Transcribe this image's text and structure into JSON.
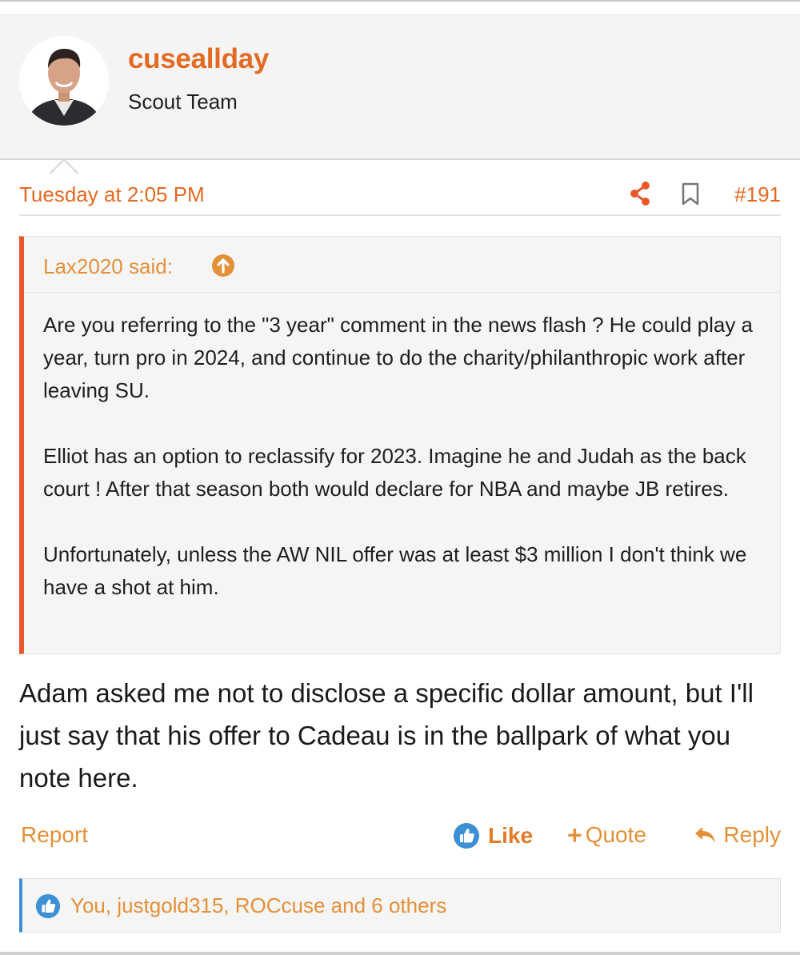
{
  "author": {
    "username": "cuseallday",
    "title": "Scout Team",
    "avatar": "avatar"
  },
  "post": {
    "date": "Tuesday at 2:05 PM",
    "number": "#191",
    "share_icon": "share-icon",
    "bookmark_icon": "bookmark-icon"
  },
  "quote": {
    "author_label": "Lax2020 said:",
    "jump_icon": "arrow-up-circle-icon",
    "paragraphs": [
      "Are you referring to the \"3 year\" comment in the news flash ? He could play a year, turn pro in 2024, and continue to do the charity/philanthropic work after leaving SU.",
      "Elliot has an option to reclassify for 2023. Imagine he and Judah as the back court ! After that season both would declare for NBA and maybe JB retires.",
      "Unfortunately, unless the AW NIL offer was at least $3 million I don't think we have a shot at him."
    ]
  },
  "body": "Adam asked me not to disclose a specific dollar amount, but I'll just say that his offer to Cadeau is in the ballpark of what you note here.",
  "actions": {
    "report": "Report",
    "like": "Like",
    "quote": "Quote",
    "reply": "Reply"
  },
  "reactions": {
    "text": "You, justgold315, ROCcuse and 6 others"
  },
  "colors": {
    "accent": "#e36a23",
    "link": "#e49038",
    "quote_bar": "#e8582a",
    "like_blue": "#3d8fd6"
  }
}
